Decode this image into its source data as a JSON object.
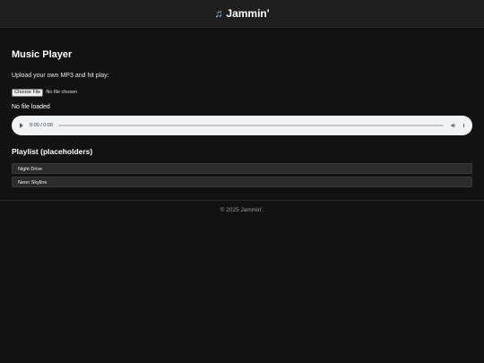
{
  "header": {
    "icon": "musical-note-icon",
    "title": "Jammin'"
  },
  "main": {
    "title": "Music Player",
    "upload_text": "Upload your own MP3 and hit play:",
    "file_input": {
      "button_label": "Choose File",
      "status": "No file chosen"
    },
    "status": "No file loaded",
    "audio": {
      "time": "0:00 / 0:00",
      "progress": 0
    }
  },
  "playlist": {
    "title": "Playlist (placeholders)",
    "items": [
      {
        "label": "Night Drive"
      },
      {
        "label": "Neon Skyline"
      }
    ]
  },
  "footer": {
    "text": "© 2025 Jammin'."
  }
}
